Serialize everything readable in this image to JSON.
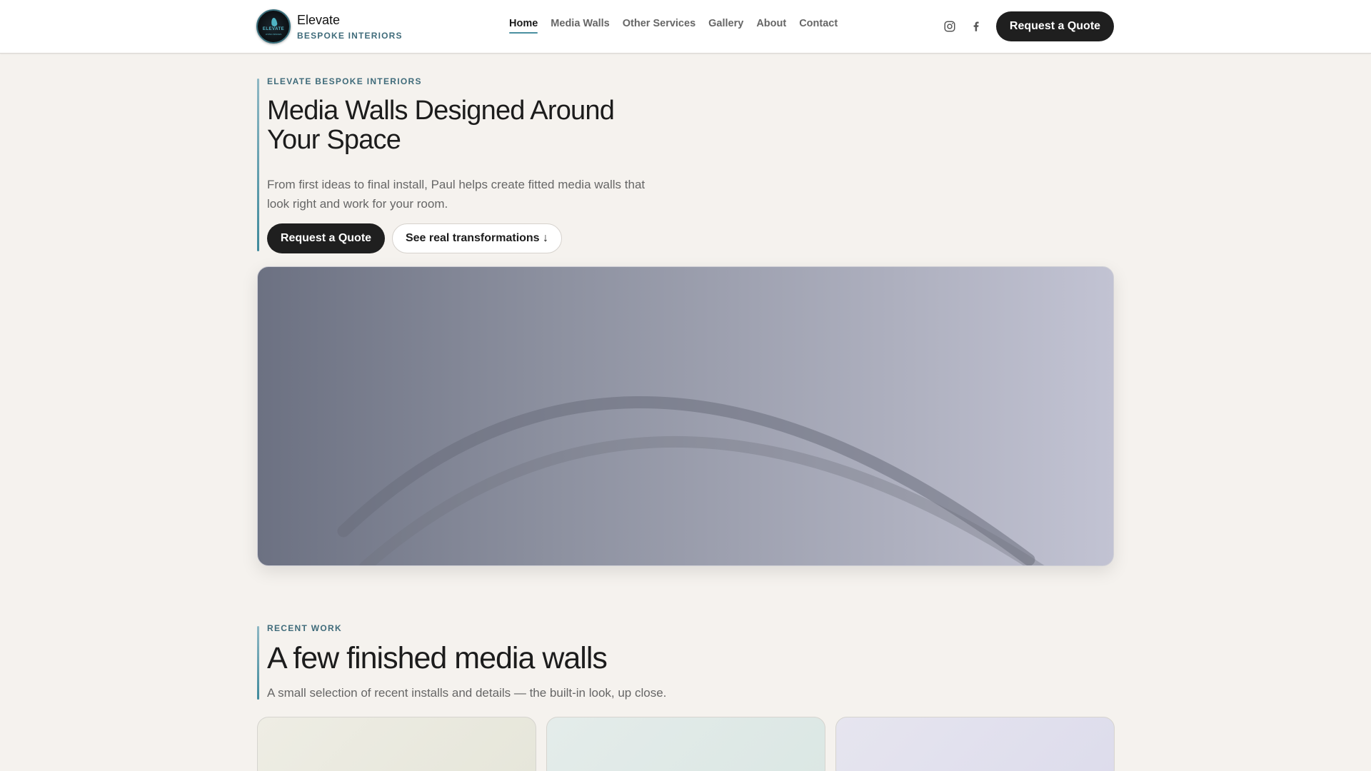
{
  "brand": {
    "name": "Elevate",
    "subtitle": "BESPOKE INTERIORS",
    "logo_text": "ELEVATE",
    "logo_subtext": "LIVING SPACES"
  },
  "nav": {
    "items": [
      {
        "label": "Home",
        "active": true
      },
      {
        "label": "Media Walls",
        "active": false
      },
      {
        "label": "Other Services",
        "active": false
      },
      {
        "label": "Gallery",
        "active": false
      },
      {
        "label": "About",
        "active": false
      },
      {
        "label": "Contact",
        "active": false
      }
    ]
  },
  "header": {
    "social": [
      {
        "icon": "instagram-icon"
      },
      {
        "icon": "facebook-icon"
      }
    ],
    "cta_label": "Request a Quote"
  },
  "hero": {
    "eyebrow": "ELEVATE BESPOKE INTERIORS",
    "title": "Media Walls Designed Around Your Space",
    "description": "From first ideas to final install, Paul helps create fitted media walls that look right and work for your room.",
    "primary_button": "Request a Quote",
    "secondary_button": "See real transformations ↓"
  },
  "recent_work": {
    "eyebrow": "RECENT WORK",
    "title": "A few finished media walls",
    "description": "A small selection of recent installs and details — the built-in look, up close."
  },
  "colors": {
    "accent": "#3f6b7a",
    "dark_button": "#1f1f1f",
    "page_background": "#f5f2ee"
  }
}
